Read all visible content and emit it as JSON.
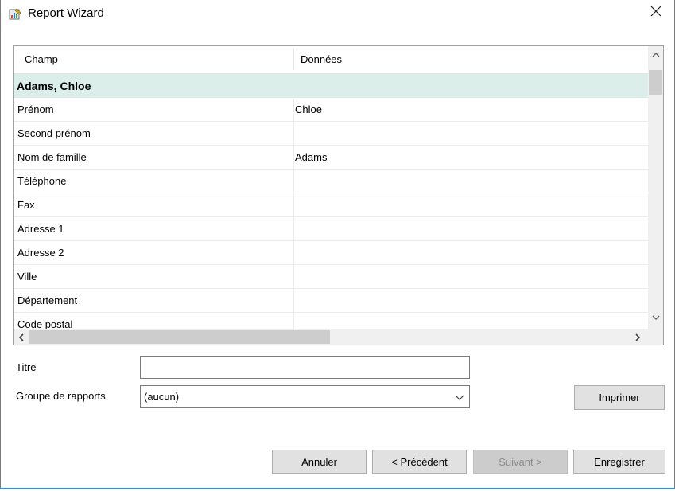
{
  "window": {
    "title": "Report Wizard",
    "accent_color": "#2b8fd8",
    "icon": "report-wizard-icon",
    "close_icon": "close-icon"
  },
  "grid": {
    "columns": [
      "Champ",
      "Données"
    ],
    "group": {
      "label": "Adams, Chloe",
      "background": "#dbeee9"
    },
    "rows": [
      {
        "field": "Prénom",
        "value": "Chloe"
      },
      {
        "field": "Second prénom",
        "value": ""
      },
      {
        "field": "Nom de famille",
        "value": "Adams"
      },
      {
        "field": "Téléphone",
        "value": ""
      },
      {
        "field": "Fax",
        "value": ""
      },
      {
        "field": "Adresse 1",
        "value": ""
      },
      {
        "field": "Adresse 2",
        "value": ""
      },
      {
        "field": "Ville",
        "value": ""
      },
      {
        "field": "Département",
        "value": ""
      },
      {
        "field": "Code postal",
        "value": ""
      }
    ]
  },
  "form": {
    "title_label": "Titre",
    "title_value": "",
    "group_label": "Groupe de rapports",
    "group_value": "(aucun)"
  },
  "buttons": {
    "print": "Imprimer",
    "cancel": "Annuler",
    "previous": "< Précédent",
    "next": "Suivant >",
    "save": "Enregistrer"
  }
}
